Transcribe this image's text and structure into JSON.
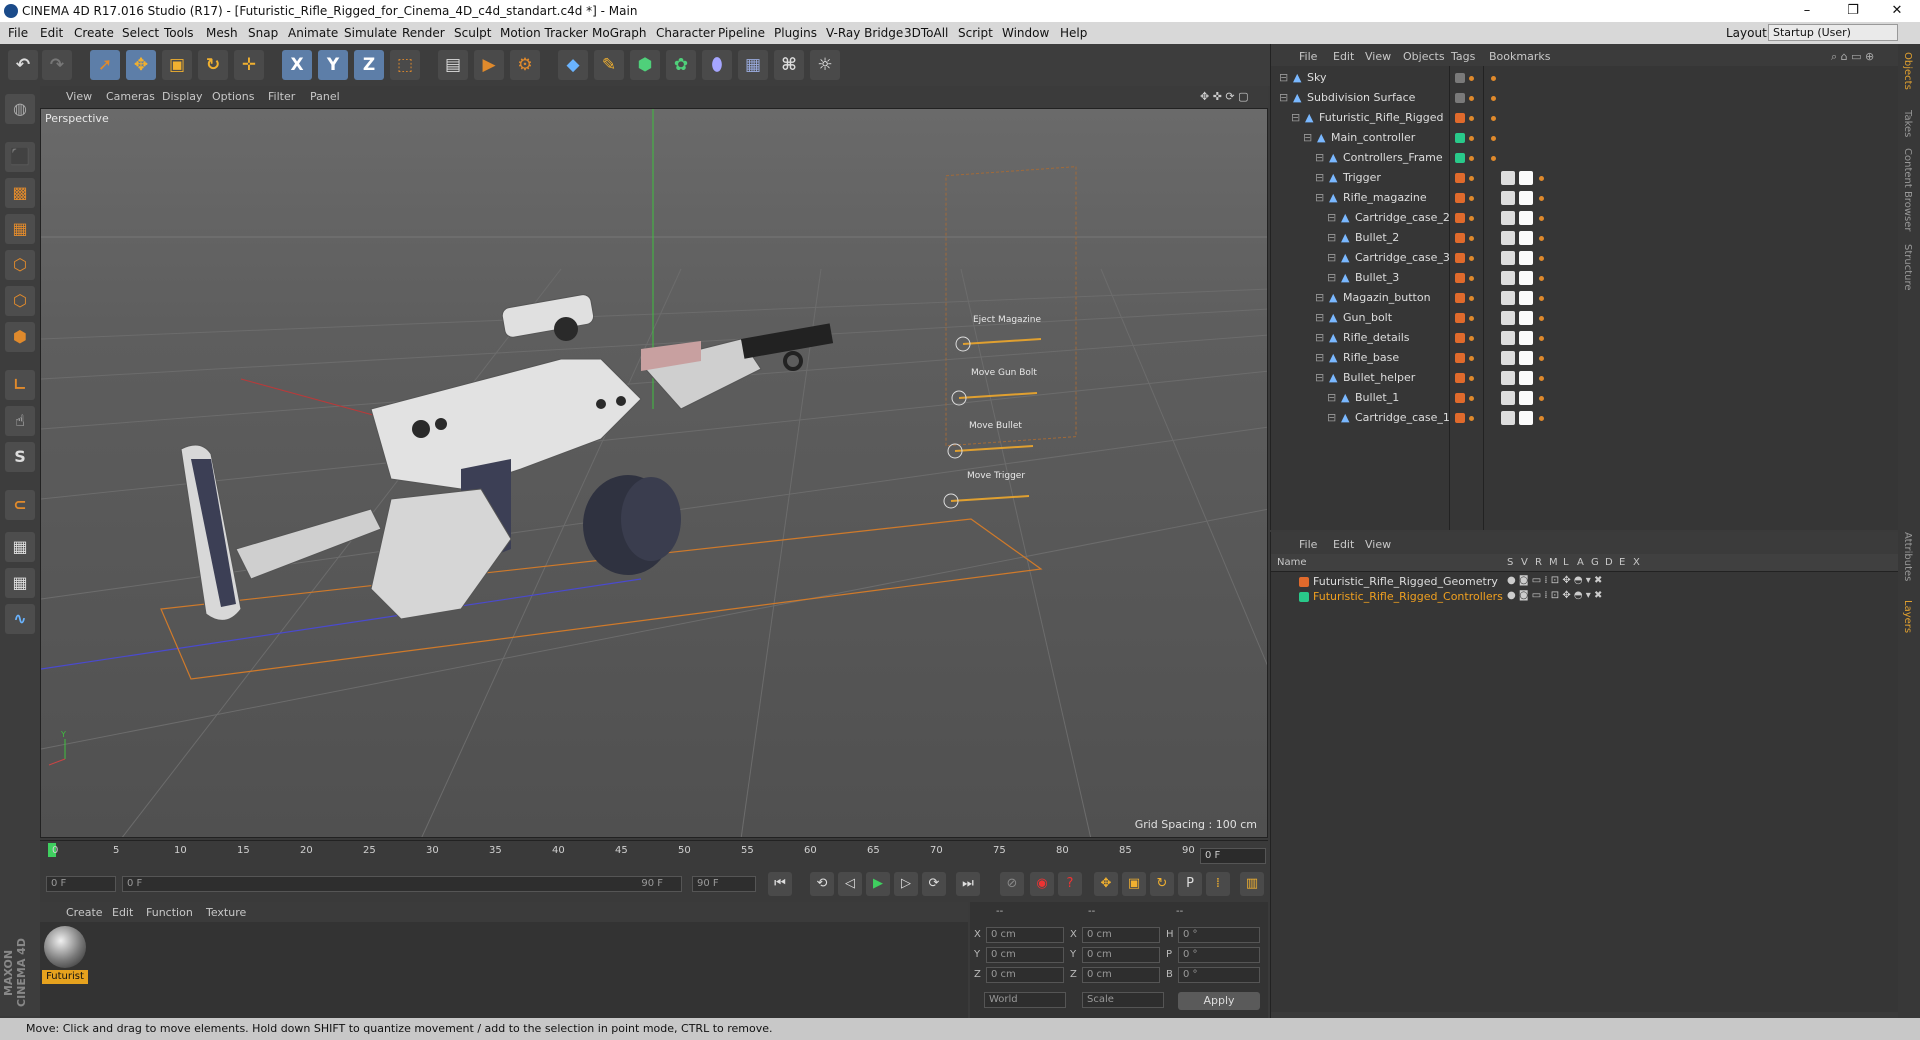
{
  "window": {
    "title": "CINEMA 4D R17.016 Studio (R17) - [Futuristic_Rifle_Rigged_for_Cinema_4D_c4d_standart.c4d *] - Main"
  },
  "menubar": {
    "items": [
      "File",
      "Edit",
      "Create",
      "Select",
      "Tools",
      "Mesh",
      "Snap",
      "Animate",
      "Simulate",
      "Render",
      "Sculpt",
      "Motion Tracker",
      "MoGraph",
      "Character",
      "Pipeline",
      "Plugins",
      "V-Ray Bridge",
      "3DToAll",
      "Script",
      "Window",
      "Help"
    ],
    "layout_label": "Layout:",
    "layout_value": "Startup (User)"
  },
  "toolbar": {
    "icons": [
      "undo-icon",
      "redo-icon",
      "select-arrow-icon",
      "move-icon",
      "scale-icon",
      "rotate-icon",
      "move-cross-icon",
      "x-axis-icon",
      "y-axis-icon",
      "z-axis-icon",
      "world-coord-icon",
      "render-view-icon",
      "render-picture-icon",
      "render-settings-icon",
      "cube-icon",
      "pen-icon",
      "subdivide-icon",
      "array-icon",
      "deformer-icon",
      "floor-icon",
      "camera-icon",
      "light-icon"
    ],
    "axis_x": "X",
    "axis_y": "Y",
    "axis_z": "Z"
  },
  "viewport": {
    "menu": [
      "View",
      "Cameras",
      "Display",
      "Options",
      "Filter",
      "Panel"
    ],
    "label": "Perspective",
    "grid_spacing": "Grid Spacing : 100 cm",
    "controller_labels": [
      "Eject Magazine",
      "Move Gun Bolt",
      "Move Bullet",
      "Move Trigger"
    ],
    "axis_y_label": "Y"
  },
  "timeline": {
    "ticks": [
      "0",
      "5",
      "10",
      "15",
      "20",
      "25",
      "30",
      "35",
      "40",
      "45",
      "50",
      "55",
      "60",
      "65",
      "70",
      "75",
      "80",
      "85",
      "90"
    ],
    "current_frame": "0 F",
    "start_field": "0 F",
    "range_start": "0 F",
    "range_end": "90 F",
    "end_field": "90 F"
  },
  "material_manager": {
    "menu": [
      "Create",
      "Edit",
      "Function",
      "Texture"
    ],
    "material_name": "Futurist"
  },
  "coordinates": {
    "header": [
      "--",
      "--",
      "--"
    ],
    "rows": [
      {
        "a": "X",
        "av": "0 cm",
        "b": "X",
        "bv": "0 cm",
        "c": "H",
        "cv": "0 °"
      },
      {
        "a": "Y",
        "av": "0 cm",
        "b": "Y",
        "bv": "0 cm",
        "c": "P",
        "cv": "0 °"
      },
      {
        "a": "Z",
        "av": "0 cm",
        "b": "Z",
        "bv": "0 cm",
        "c": "B",
        "cv": "0 °"
      }
    ],
    "mode1": "World",
    "mode2": "Scale",
    "apply": "Apply"
  },
  "object_manager": {
    "menu": [
      "File",
      "Edit",
      "View",
      "Objects",
      "Tags",
      "Bookmarks"
    ],
    "objects": [
      {
        "name": "Sky",
        "indent": 0,
        "color": "#7a7a7a"
      },
      {
        "name": "Subdivision Surface",
        "indent": 0,
        "color": "#7a7a7a"
      },
      {
        "name": "Futuristic_Rifle_Rigged",
        "indent": 1,
        "color": "#e06a2c"
      },
      {
        "name": "Main_controller",
        "indent": 2,
        "color": "#29c98a"
      },
      {
        "name": "Controllers_Frame",
        "indent": 3,
        "color": "#29c98a"
      },
      {
        "name": "Trigger",
        "indent": 3,
        "color": "#e06a2c"
      },
      {
        "name": "Rifle_magazine",
        "indent": 3,
        "color": "#e06a2c"
      },
      {
        "name": "Cartridge_case_2",
        "indent": 4,
        "color": "#e06a2c"
      },
      {
        "name": "Bullet_2",
        "indent": 4,
        "color": "#e06a2c"
      },
      {
        "name": "Cartridge_case_3",
        "indent": 4,
        "color": "#e06a2c"
      },
      {
        "name": "Bullet_3",
        "indent": 4,
        "color": "#e06a2c"
      },
      {
        "name": "Magazin_button",
        "indent": 3,
        "color": "#e06a2c"
      },
      {
        "name": "Gun_bolt",
        "indent": 3,
        "color": "#e06a2c"
      },
      {
        "name": "Rifle_details",
        "indent": 3,
        "color": "#e06a2c"
      },
      {
        "name": "Rifle_base",
        "indent": 3,
        "color": "#e06a2c"
      },
      {
        "name": "Bullet_helper",
        "indent": 3,
        "color": "#e06a2c"
      },
      {
        "name": "Bullet_1",
        "indent": 4,
        "color": "#e06a2c"
      },
      {
        "name": "Cartridge_case_1",
        "indent": 4,
        "color": "#e06a2c"
      }
    ]
  },
  "layer_manager": {
    "menu": [
      "File",
      "Edit",
      "View"
    ],
    "columns": [
      "Name",
      "S",
      "V",
      "R",
      "M",
      "L",
      "A",
      "G",
      "D",
      "E",
      "X"
    ],
    "layers": [
      {
        "name": "Futuristic_Rifle_Rigged_Geometry",
        "color": "#e06a2c",
        "text_color": "#dddddd"
      },
      {
        "name": "Futuristic_Rifle_Rigged_Controllers",
        "color": "#29c98a",
        "text_color": "#f0a020"
      }
    ]
  },
  "side_tabs": [
    "Objects",
    "Takes",
    "Content Browser",
    "Structure",
    "Attributes",
    "Layers"
  ],
  "status": "Move: Click and drag to move elements. Hold down SHIFT to quantize movement / add to the selection in point mode, CTRL to remove.",
  "logo": "MAXON CINEMA 4D"
}
